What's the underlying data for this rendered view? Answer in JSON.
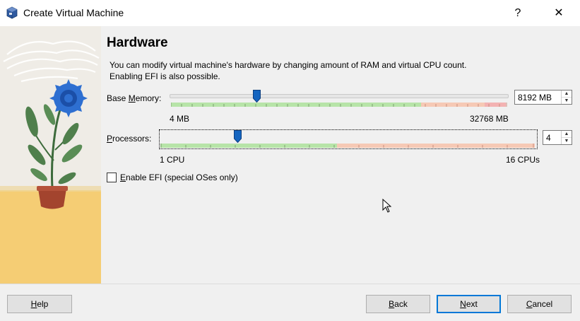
{
  "window": {
    "title": "Create Virtual Machine",
    "help_glyph": "?",
    "close_glyph": "✕"
  },
  "page": {
    "heading": "Hardware",
    "description_line1": "You can modify virtual machine's hardware by changing amount of RAM and virtual CPU count.",
    "description_line2": "Enabling EFI is also possible."
  },
  "memory": {
    "label_prefix": "Base ",
    "label_accel": "M",
    "label_rest": "emory:",
    "min_label": "4 MB",
    "max_label": "32768 MB",
    "value_text": "8192 MB",
    "value": 8192,
    "min": 4,
    "max": 32768
  },
  "processors": {
    "label_accel": "P",
    "label_rest": "rocessors:",
    "min_label": "1 CPU",
    "max_label": "16 CPUs",
    "value_text": "4",
    "value": 4,
    "min": 1,
    "max": 16
  },
  "efi": {
    "label_accel": "E",
    "label_rest": "nable EFI (special OSes only)",
    "checked": false
  },
  "buttons": {
    "help": {
      "accel": "H",
      "rest": "elp"
    },
    "back": {
      "accel": "B",
      "rest": "ack"
    },
    "next": {
      "accel": "N",
      "rest": "ext"
    },
    "cancel": {
      "accel": "C",
      "rest": "ancel"
    }
  },
  "colors": {
    "accent": "#0078d7",
    "slider_green": "#b7e4a8",
    "slider_red": "#f2b8a6",
    "slider_handle": "#1565c0"
  }
}
